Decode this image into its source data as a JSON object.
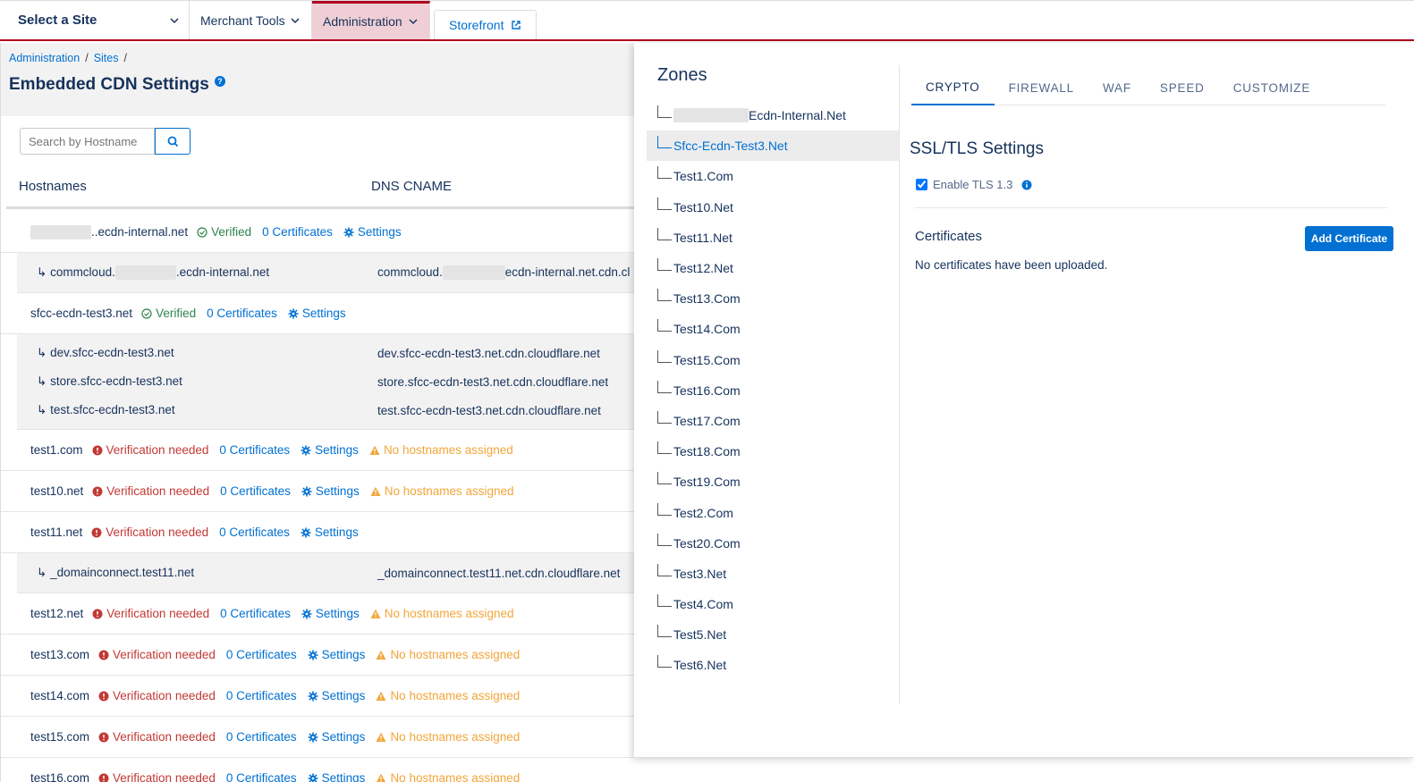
{
  "nav": {
    "site_select": "Select a Site",
    "merchant_tools": "Merchant Tools",
    "administration": "Administration",
    "storefront": "Storefront"
  },
  "breadcrumb": [
    "Administration",
    "Sites"
  ],
  "page_title": "Embedded CDN Settings",
  "search": {
    "placeholder": "Search by Hostname"
  },
  "columns": {
    "hostnames": "Hostnames",
    "dns_cname": "DNS CNAME"
  },
  "rows": {
    "r0": {
      "host": "..ecdn-internal.net",
      "status": "Verified",
      "certs": "0 Certificates",
      "settings": "Settings"
    },
    "r0_sub": {
      "host_prefix": "commcloud.",
      "host_suffix": ".ecdn-internal.net",
      "cname_prefix": "commcloud.",
      "cname_suffix": "ecdn-internal.net.cdn.cl"
    },
    "r1": {
      "host": "sfcc-ecdn-test3.net",
      "status": "Verified",
      "certs": "0 Certificates",
      "settings": "Settings"
    },
    "r1_sub": [
      {
        "host": "dev.sfcc-ecdn-test3.net",
        "cname": "dev.sfcc-ecdn-test3.net.cdn.cloudflare.net"
      },
      {
        "host": "store.sfcc-ecdn-test3.net",
        "cname": "store.sfcc-ecdn-test3.net.cdn.cloudflare.net"
      },
      {
        "host": "test.sfcc-ecdn-test3.net",
        "cname": "test.sfcc-ecdn-test3.net.cdn.cloudflare.net"
      }
    ],
    "r2": {
      "host": "test1.com",
      "status": "Verification needed",
      "certs": "0 Certificates",
      "settings": "Settings",
      "warn": "No hostnames assigned"
    },
    "r3": {
      "host": "test10.net",
      "status": "Verification needed",
      "certs": "0 Certificates",
      "settings": "Settings",
      "warn": "No hostnames assigned"
    },
    "r4": {
      "host": "test11.net",
      "status": "Verification needed",
      "certs": "0 Certificates",
      "settings": "Settings"
    },
    "r4_sub": {
      "host": "_domainconnect.test11.net",
      "cname": "_domainconnect.test11.net.cdn.cloudflare.net"
    },
    "r5": {
      "host": "test12.net",
      "status": "Verification needed",
      "certs": "0 Certificates",
      "settings": "Settings",
      "warn": "No hostnames assigned"
    },
    "r6": {
      "host": "test13.com",
      "status": "Verification needed",
      "certs": "0 Certificates",
      "settings": "Settings",
      "warn": "No hostnames assigned"
    },
    "r7": {
      "host": "test14.com",
      "status": "Verification needed",
      "certs": "0 Certificates",
      "settings": "Settings",
      "warn": "No hostnames assigned"
    },
    "r8": {
      "host": "test15.com",
      "status": "Verification needed",
      "certs": "0 Certificates",
      "settings": "Settings",
      "warn": "No hostnames assigned"
    },
    "r9": {
      "host": "test16.com",
      "status": "Verification needed",
      "certs": "0 Certificates",
      "settings": "Settings",
      "warn": "No hostnames assigned"
    }
  },
  "zones": {
    "title": "Zones",
    "items": [
      "Ecdn-Internal.Net",
      "Sfcc-Ecdn-Test3.Net",
      "Test1.Com",
      "Test10.Net",
      "Test11.Net",
      "Test12.Net",
      "Test13.Com",
      "Test14.Com",
      "Test15.Com",
      "Test16.Com",
      "Test17.Com",
      "Test18.Com",
      "Test19.Com",
      "Test2.Com",
      "Test20.Com",
      "Test3.Net",
      "Test4.Com",
      "Test5.Net",
      "Test6.Net"
    ],
    "active_index": 1
  },
  "tabs": [
    "CRYPTO",
    "FIREWALL",
    "WAF",
    "SPEED",
    "CUSTOMIZE"
  ],
  "crypto": {
    "ssl_title": "SSL/TLS Settings",
    "tls_label": "Enable TLS 1.3",
    "tls_checked": true,
    "certificates_title": "Certificates",
    "add_button": "Add Certificate",
    "no_certs": "No certificates have been uploaded."
  },
  "colors": {
    "accent": "#0070d2",
    "brand": "#b00020",
    "verified": "#2e844a",
    "error": "#c23934",
    "warning": "#f2a63a"
  }
}
